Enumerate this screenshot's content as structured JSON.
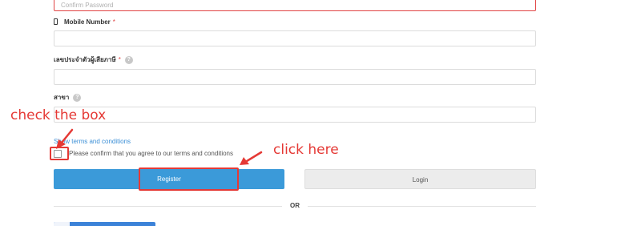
{
  "form": {
    "confirm_password": {
      "placeholder": "Confirm Password"
    },
    "mobile": {
      "label": "Mobile Number",
      "required_mark": "*",
      "value": ""
    },
    "taxid": {
      "label": "เลขประจำตัวผู้เสียภาษี",
      "required_mark": "*",
      "help": "?",
      "value": ""
    },
    "branch": {
      "label": "สาขา",
      "help": "?",
      "value": ""
    },
    "terms_link": "Show terms and conditions",
    "agree_text": "Please confirm that you agree to our terms and conditions",
    "agree_checked": false
  },
  "buttons": {
    "register": "Register",
    "login": "Login"
  },
  "divider": {
    "text": "OR"
  },
  "annotations": {
    "check_box": "check the box",
    "click_here": "click here",
    "color": "#e53935"
  },
  "colors": {
    "primary": "#3b9ad9",
    "error_border": "#e14444",
    "link": "#3b8fd6"
  }
}
